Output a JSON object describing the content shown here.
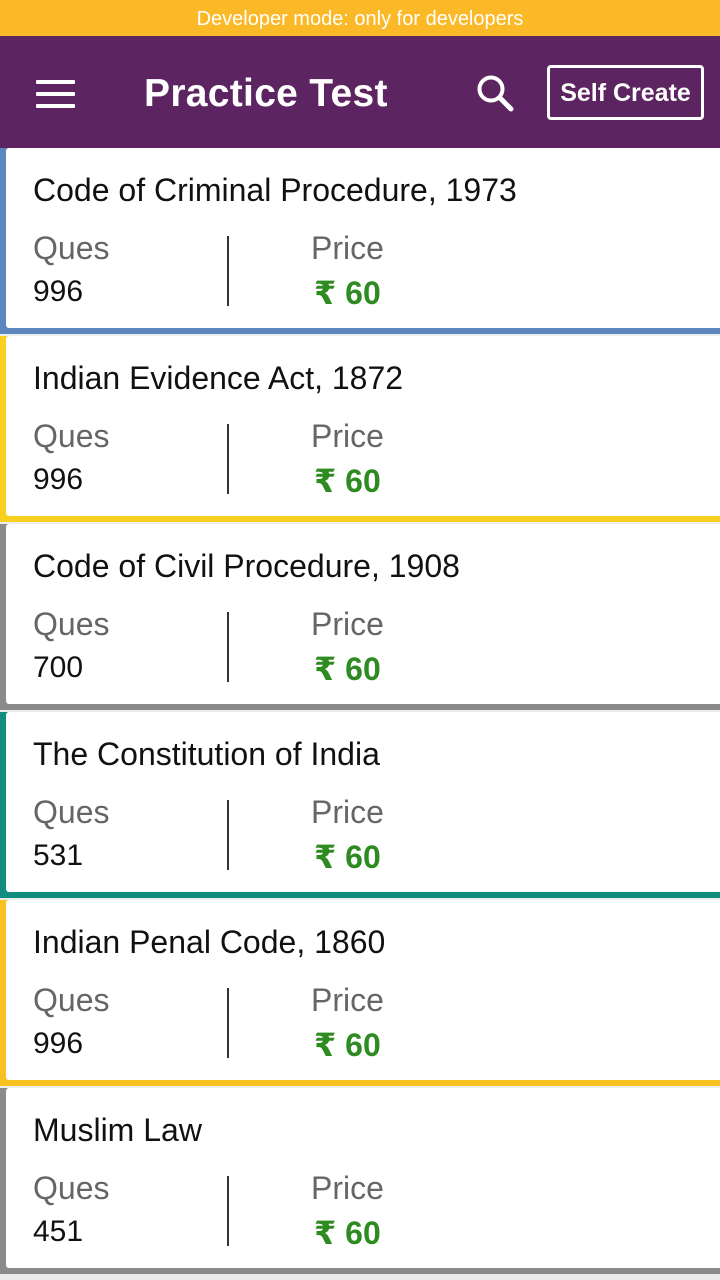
{
  "dev_banner": "Developer mode: only for developers",
  "app_bar": {
    "title": "Practice Test",
    "menu_icon": "hamburger-menu-icon",
    "search_icon": "search-icon",
    "self_create_label": "Self Create",
    "background_color": "#5c2460"
  },
  "banner_color": "#fbb827",
  "price_color": "#2e8b22",
  "cards": [
    {
      "title": "Code of Criminal Procedure, 1973",
      "ques_label": "Ques",
      "ques": "996",
      "price_label": "Price",
      "price": "₹ 60",
      "accent_color": "#5b86c0"
    },
    {
      "title": "Indian Evidence Act, 1872",
      "ques_label": "Ques",
      "ques": "996",
      "price_label": "Price",
      "price": "₹ 60",
      "accent_color": "#f9d01e"
    },
    {
      "title": "Code of Civil Procedure, 1908",
      "ques_label": "Ques",
      "ques": "700",
      "price_label": "Price",
      "price": "₹ 60",
      "accent_color": "#8a8a8a"
    },
    {
      "title": "The Constitution of India",
      "ques_label": "Ques",
      "ques": "531",
      "price_label": "Price",
      "price": "₹ 60",
      "accent_color": "#138c80"
    },
    {
      "title": "Indian Penal Code, 1860",
      "ques_label": "Ques",
      "ques": "996",
      "price_label": "Price",
      "price": "₹ 60",
      "accent_color": "#f7c220"
    },
    {
      "title": "Muslim Law",
      "ques_label": "Ques",
      "ques": "451",
      "price_label": "Price",
      "price": "₹ 60",
      "accent_color": "#8a8a8a"
    }
  ]
}
